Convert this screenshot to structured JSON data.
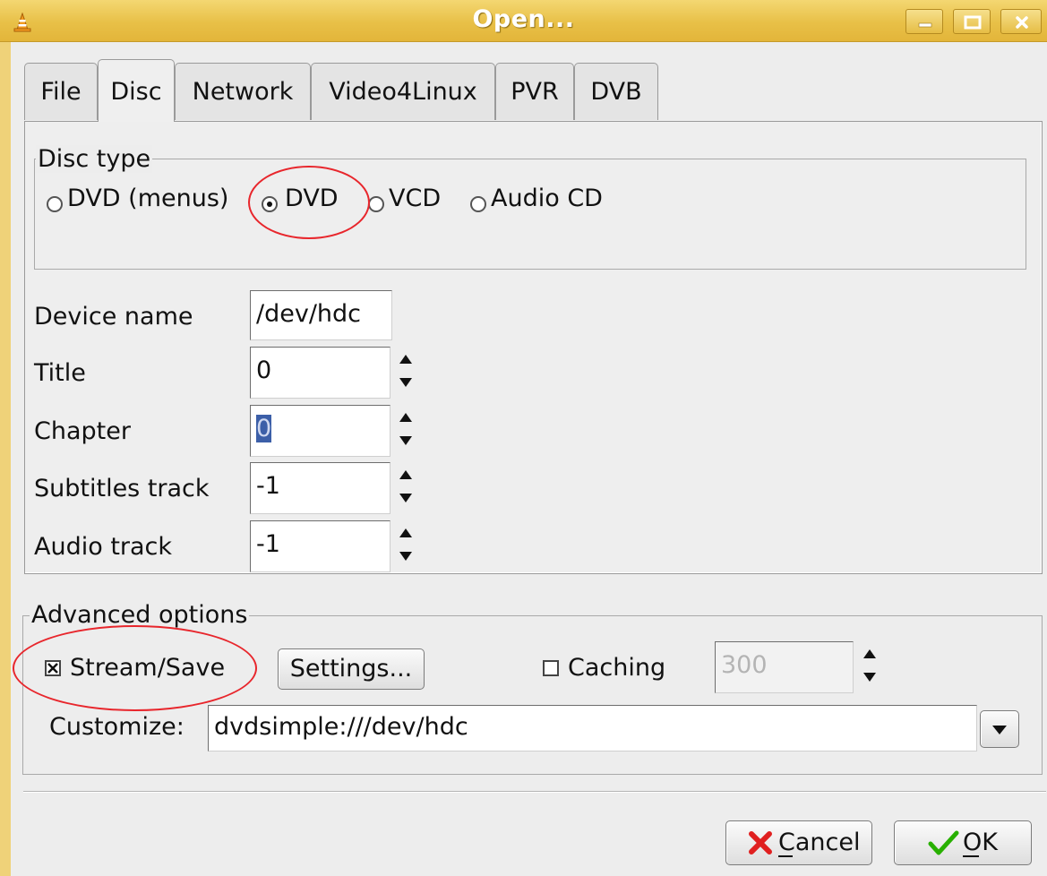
{
  "window": {
    "title": "Open...",
    "controls": {
      "minimize": "minimize-icon",
      "maximize": "maximize-icon",
      "close": "close-icon"
    }
  },
  "tabs": [
    {
      "label": "File",
      "active": false
    },
    {
      "label": "Disc",
      "active": true
    },
    {
      "label": "Network",
      "active": false
    },
    {
      "label": "Video4Linux",
      "active": false
    },
    {
      "label": "PVR",
      "active": false
    },
    {
      "label": "DVB",
      "active": false
    }
  ],
  "disc_type": {
    "legend": "Disc type",
    "options": [
      {
        "label": "DVD (menus)",
        "selected": false
      },
      {
        "label": "DVD",
        "selected": true
      },
      {
        "label": "VCD",
        "selected": false
      },
      {
        "label": "Audio CD",
        "selected": false
      }
    ]
  },
  "fields": {
    "device_name": {
      "label": "Device name",
      "value": "/dev/hdc"
    },
    "title": {
      "label": "Title",
      "value": "0"
    },
    "chapter": {
      "label": "Chapter",
      "value": "0"
    },
    "subtitles_track": {
      "label": "Subtitles track",
      "value": "-1"
    },
    "audio_track": {
      "label": "Audio track",
      "value": "-1"
    }
  },
  "advanced": {
    "legend": "Advanced options",
    "stream_save": {
      "label": "Stream/Save",
      "checked": true
    },
    "settings_button": "Settings...",
    "caching": {
      "label": "Caching",
      "checked": false,
      "value": "300"
    },
    "customize": {
      "label": "Customize:",
      "value": "dvdsimple:///dev/hdc"
    }
  },
  "buttons": {
    "cancel": "Cancel",
    "ok": "OK"
  },
  "colors": {
    "titlebar": "#e8c047",
    "window_bg": "#ededed",
    "annotation": "#e8262c",
    "selection": "#3c5fa8",
    "cancel_icon": "#e02020",
    "ok_icon": "#28b000"
  }
}
